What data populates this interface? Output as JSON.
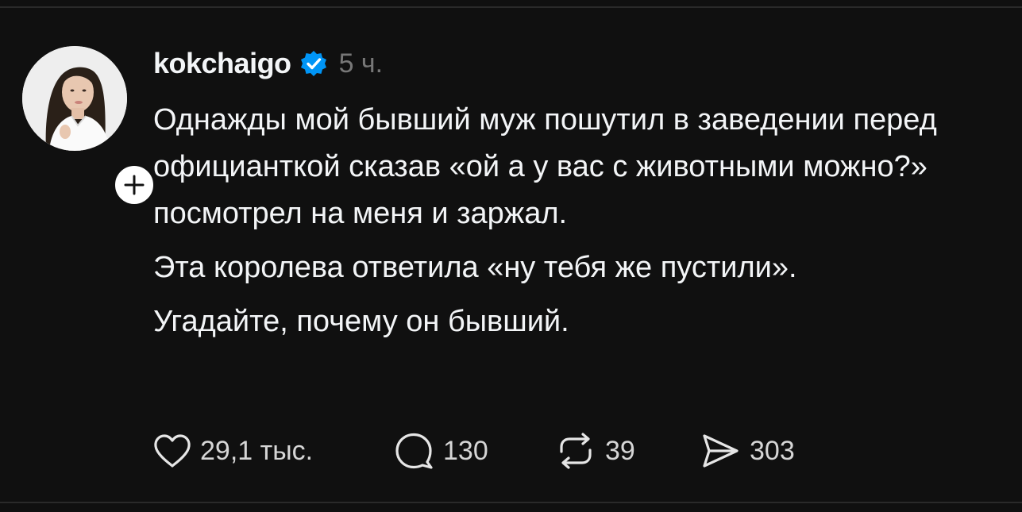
{
  "post": {
    "username": "kokchaigo",
    "time": "5 ч.",
    "paragraphs": [
      "Однажды мой бывший муж пошутил в заведении перед официанткой сказав «ой а у вас с животными можно?» посмотрел на меня и заржал.",
      "Эта королева ответила «ну тебя же пустили».",
      "Угадайте, почему он бывший."
    ],
    "verified_icon": "verified-badge-icon",
    "accent_color": "#0095f6"
  },
  "actions": {
    "likes": "29,1 тыс.",
    "comments": "130",
    "reposts": "39",
    "shares": "303"
  }
}
